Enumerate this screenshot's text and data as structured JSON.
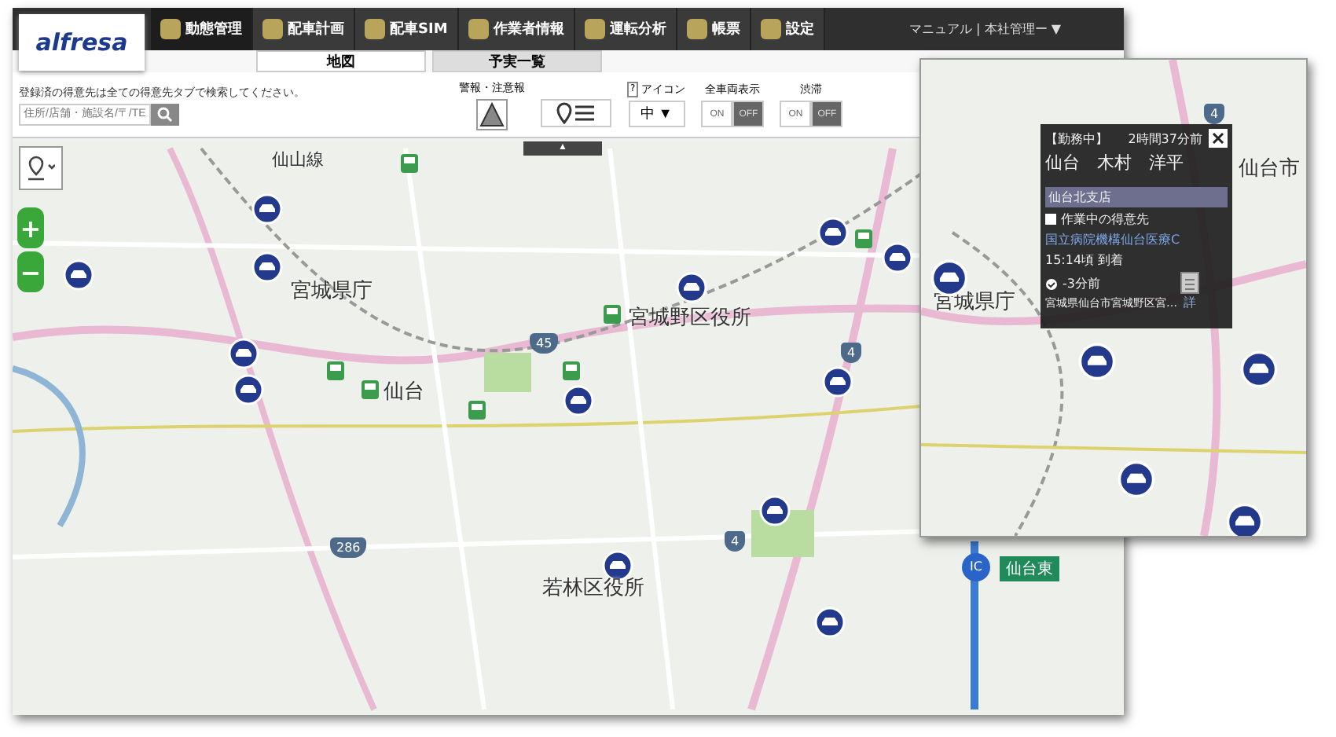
{
  "logo": "alfresa",
  "nav": [
    {
      "label": "動態管理",
      "selected": true
    },
    {
      "label": "配車計画",
      "selected": false
    },
    {
      "label": "配車SIM",
      "selected": false
    },
    {
      "label": "作業者情報",
      "selected": false
    },
    {
      "label": "運転分析",
      "selected": false
    },
    {
      "label": "帳票",
      "selected": false
    },
    {
      "label": "設定",
      "selected": false
    }
  ],
  "user_menu": "マニュアル | 本社管理ー ▼",
  "tabs": [
    {
      "label": "地図",
      "selected": true
    },
    {
      "label": "予実一覧",
      "selected": false
    }
  ],
  "search": {
    "hint": "登録済の得意先は全ての得意先タブで検索してください。",
    "placeholder": "住所/店舗・施設名/〒/TE"
  },
  "warning": {
    "label": "警報・注意報"
  },
  "icon_size": {
    "help": "?",
    "label": "アイコン",
    "value": "中",
    "caret": "▼"
  },
  "zoom": {
    "in": "+",
    "out": "−"
  },
  "toggles": [
    {
      "label": "全車両表示",
      "on": false,
      "on_text": "ON",
      "off_text": "OFF"
    },
    {
      "label": "渋滞",
      "on": false,
      "on_text": "ON",
      "off_text": "OFF"
    }
  ],
  "collapse": "▲",
  "map": {
    "labels": [
      {
        "kind": "line",
        "text": "仙山線"
      },
      {
        "kind": "place",
        "text": "宮城県庁"
      },
      {
        "kind": "place",
        "text": "宮城野区役所"
      },
      {
        "kind": "station",
        "text": "仙台"
      },
      {
        "kind": "place",
        "text": "若林区役所"
      },
      {
        "kind": "shield",
        "text": "45"
      },
      {
        "kind": "shield",
        "text": "4"
      },
      {
        "kind": "shield",
        "text": "286"
      },
      {
        "kind": "shield",
        "text": "4"
      },
      {
        "kind": "ic",
        "text": "IC"
      },
      {
        "kind": "exit",
        "text": "仙台東"
      }
    ]
  },
  "inset": {
    "labels": [
      {
        "kind": "shield",
        "text": "4"
      },
      {
        "kind": "city",
        "text": "仙台市"
      },
      {
        "kind": "city",
        "text": "宮城県庁"
      }
    ],
    "popup": {
      "status": "【勤務中】",
      "elapsed": "2時間37分前",
      "name": "仙台　木村　洋平",
      "branch": "仙台北支店",
      "section": "作業中の得意先",
      "customer": "国立病院機構仙台医療C",
      "arrival": "15:14頃 到着",
      "updated": "-3分前",
      "address": "宮城県仙台市宮城野区宮…",
      "detail": "詳"
    }
  }
}
